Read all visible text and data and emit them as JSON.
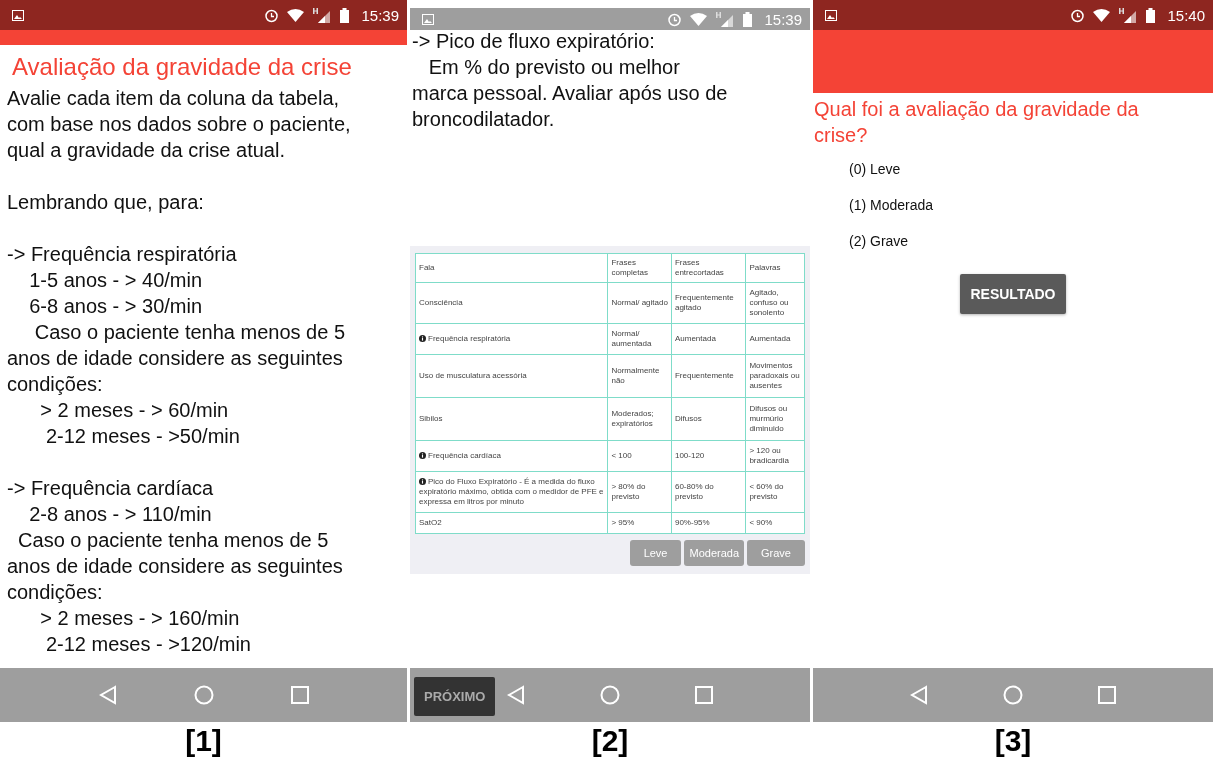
{
  "panels": [
    {
      "kind": "text",
      "caption": "[1]",
      "status_bar": {
        "time": "15:39"
      },
      "title": "Avaliação da gravidade da crise",
      "paragraphs": [
        [
          "Avalie cada item da coluna da tabela,",
          "com base nos dados sobre o paciente,",
          "qual a gravidade da crise atual."
        ],
        [
          "Lembrando que, para:"
        ],
        [
          "-> Frequência respiratória",
          "    1-5 anos - > 40/min",
          "    6-8 anos - > 30/min",
          "     Caso o paciente tenha menos de 5",
          "anos de idade considere as seguintes",
          "condições:",
          "      > 2 meses - > 60/min",
          "       2-12 meses - >50/min"
        ],
        [
          "-> Frequência cardíaca",
          "    2-8 anos - > 110/min",
          "  Caso o paciente tenha menos de 5",
          "anos de idade considere as seguintes",
          "condições:",
          "      > 2 meses - > 160/min",
          "       2-12 meses - >120/min"
        ]
      ]
    },
    {
      "kind": "table",
      "caption": "[2]",
      "status_bar": {
        "time": "15:39"
      },
      "lines": [
        "-> Pico de fluxo expiratório:",
        "   Em % do previsto ou melhor",
        "marca pessoal. Avaliar após uso de",
        "broncodilatador."
      ],
      "table": {
        "rows": [
          {
            "info": false,
            "cells": [
              "Fala",
              "Frases completas",
              "Frases entrecortadas",
              "Palavras"
            ]
          },
          {
            "info": false,
            "cells": [
              "Consciência",
              "Normal/ agitado",
              "Frequentemente agitado",
              "Agitado, confuso ou sonolento"
            ]
          },
          {
            "info": true,
            "cells": [
              "Frequência respiratória",
              "Normal/ aumentada",
              "Aumentada",
              "Aumentada"
            ]
          },
          {
            "info": false,
            "cells": [
              "Uso de musculatura acessória",
              "Normalmente não",
              "Frequentemente",
              "Movimentos paradoxais ou ausentes"
            ]
          },
          {
            "info": false,
            "cells": [
              "Sibilos",
              "Moderados; expiratórios",
              "Difusos",
              "Difusos ou murmúrio diminuido"
            ]
          },
          {
            "info": true,
            "cells": [
              "Frequência cardíaca",
              "< 100",
              "100-120",
              "> 120 ou bradicardia"
            ]
          },
          {
            "info": true,
            "cells": [
              "Pico do Fluxo Expiratório - É a medida do fluxo expiratório máximo, obtida com o medidor de PFE e expressa em litros por minuto",
              "> 80% do previsto",
              "60-80% do previsto",
              "< 60% do previsto"
            ]
          },
          {
            "info": false,
            "cells": [
              "SatO2",
              "> 95%",
              "90%-95%",
              "< 90%"
            ]
          }
        ],
        "buttons": [
          "Leve",
          "Moderada",
          "Grave"
        ]
      },
      "next_button": "PRÓXIMO"
    },
    {
      "kind": "question",
      "caption": "[3]",
      "status_bar": {
        "time": "15:40"
      },
      "question": "Qual foi a avaliação da gravidade da crise?",
      "options": [
        "(0) Leve",
        "(1) Moderada",
        "(2) Grave"
      ],
      "button": "RESULTADO"
    }
  ]
}
